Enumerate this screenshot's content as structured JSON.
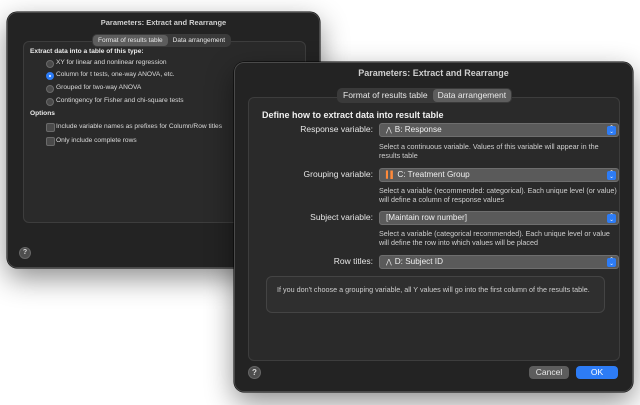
{
  "back_window": {
    "title": "Parameters: Extract and Rearrange",
    "tabs": [
      {
        "label": "Format of results table",
        "active": true
      },
      {
        "label": "Data arrangement",
        "active": false
      }
    ],
    "section_title": "Extract data into a table of this type:",
    "options": [
      {
        "label": "XY for linear and nonlinear regression",
        "selected": false
      },
      {
        "label": "Column for t tests, one-way ANOVA, etc.",
        "selected": true
      },
      {
        "label": "Grouped for two-way ANOVA",
        "selected": false
      },
      {
        "label": "Contingency for Fisher and chi-square tests",
        "selected": false
      }
    ],
    "options_header": "Options",
    "checkboxes": [
      {
        "label": "Include variable names as prefixes for Column/Row titles",
        "checked": false
      },
      {
        "label": "Only include complete rows",
        "checked": false
      }
    ],
    "help_label": "?"
  },
  "front_window": {
    "title": "Parameters: Extract and Rearrange",
    "tabs": [
      {
        "label": "Format of results table",
        "active": false
      },
      {
        "label": "Data arrangement",
        "active": true
      }
    ],
    "heading": "Define how to extract  data into result table",
    "response": {
      "label": "Response variable:",
      "value": "B: Response",
      "icon": "column-icon",
      "glyph": "⋀",
      "desc": "Select a continuous variable. Values of this variable will appear in the results table"
    },
    "grouping": {
      "label": "Grouping variable:",
      "value": "C: Treatment Group",
      "icon": "bars-icon",
      "glyph": "▍▌",
      "desc": "Select a variable (recommended: categorical). Each unique level (or value) will define a column of response values"
    },
    "subject": {
      "label": "Subject variable:",
      "value": "[Maintain row number]",
      "desc": "Select a variable (categorical recommended). Each unique level or value will define the row into which values will be placed"
    },
    "row_titles": {
      "label": "Row titles:",
      "value": "D: Subject ID",
      "icon": "column-icon",
      "glyph": "⋀"
    },
    "info": "If you don't choose a grouping variable, all Y values will go into the first column of the results table.",
    "cancel_label": "Cancel",
    "ok_label": "OK",
    "help_label": "?"
  },
  "colors": {
    "accent": "#2d7cf6",
    "window_bg": "#232323",
    "panel_bg": "#2a2a2a"
  }
}
